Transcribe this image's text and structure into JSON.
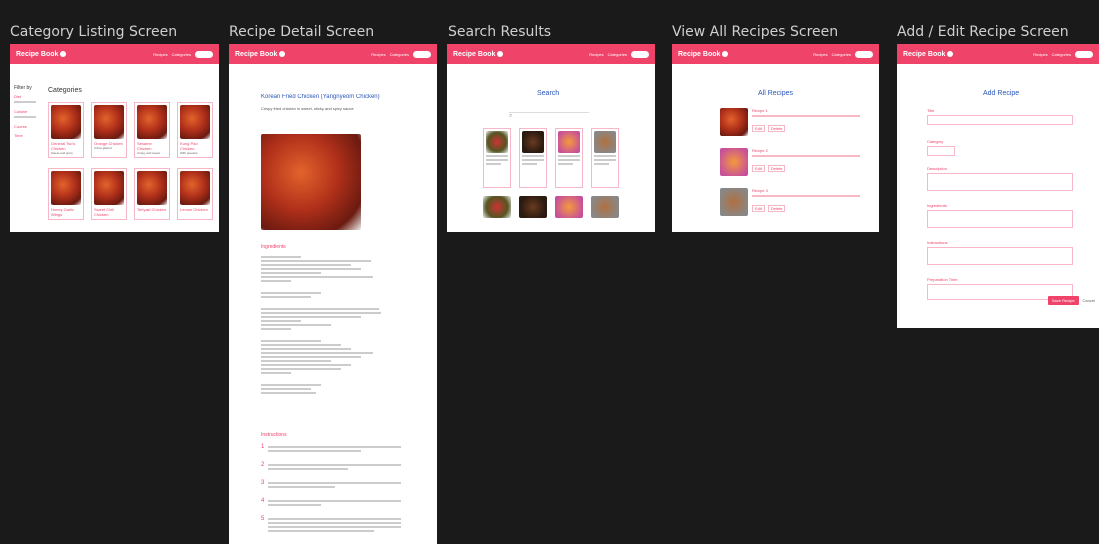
{
  "screens": {
    "category": "Category Listing Screen",
    "detail": "Recipe Detail Screen",
    "search": "Search Results",
    "view_all": "View All Recipes Screen",
    "add_edit": "Add / Edit Recipe Screen"
  },
  "app": {
    "brand": "Recipe Book",
    "nav_1": "Recipes",
    "nav_2": "Categories"
  },
  "category_screen": {
    "heading": "Categories",
    "filter_title": "Filter by",
    "filter_items": [
      "Diet",
      "Cuisine",
      "Course",
      "Time"
    ],
    "cards": [
      {
        "title": "General Tso's Chicken",
        "desc": "Sweet and spicy"
      },
      {
        "title": "Orange Chicken",
        "desc": "Citrus glazed"
      },
      {
        "title": "Sesame Chicken",
        "desc": "Crispy and sweet"
      },
      {
        "title": "Kung Pao Chicken",
        "desc": "With peanuts"
      },
      {
        "title": "Honey Garlic Wings",
        "desc": ""
      },
      {
        "title": "Sweet Chili Chicken",
        "desc": ""
      },
      {
        "title": "Teriyaki Chicken",
        "desc": ""
      },
      {
        "title": "Lemon Chicken",
        "desc": ""
      }
    ]
  },
  "detail_screen": {
    "title": "Korean Fried Chicken (Yangnyeom Chicken)",
    "subtitle": "Crispy fried chicken in sweet, sticky and spicy sauce",
    "ingredients_heading": "Ingredients",
    "instructions_heading": "Instructions"
  },
  "search_screen": {
    "heading": "Search"
  },
  "view_all_screen": {
    "heading": "All Recipes",
    "items": [
      "Recipe 1",
      "Recipe 2",
      "Recipe 3"
    ],
    "edit": "Edit",
    "delete": "Delete"
  },
  "add_edit_screen": {
    "heading": "Add Recipe",
    "fields": [
      "Title",
      "Category",
      "Description",
      "Ingredients",
      "Instructions",
      "Preparation Time"
    ],
    "save": "Save Recipe",
    "cancel": "Cancel"
  },
  "colors": {
    "accent": "#f0436a",
    "background": "#1a1a1a"
  }
}
